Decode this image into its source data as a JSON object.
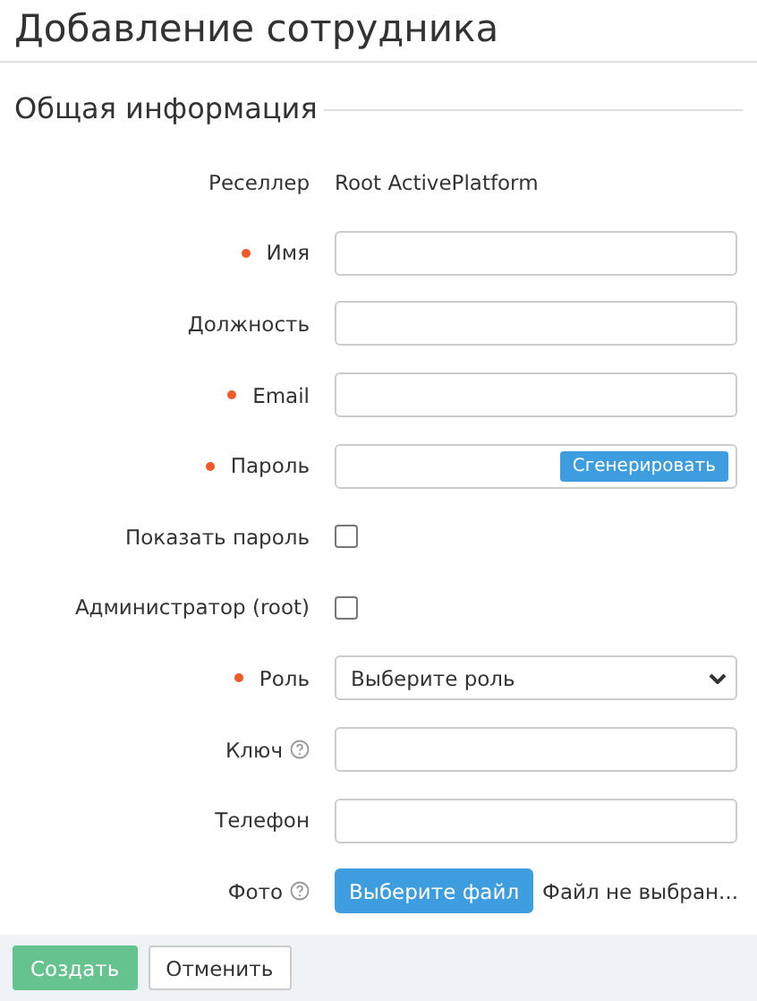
{
  "title": "Добавление сотрудника",
  "section": "Общая информация",
  "fields": [
    {
      "kind": "text",
      "label": "Реселлер",
      "required": false,
      "help": false,
      "value": "Root ActivePlatform"
    },
    {
      "kind": "input",
      "label": "Имя",
      "required": true,
      "help": false
    },
    {
      "kind": "input",
      "label": "Должность",
      "required": false,
      "help": false
    },
    {
      "kind": "input",
      "label": "Email",
      "required": true,
      "help": false
    },
    {
      "kind": "password",
      "label": "Пароль",
      "required": true,
      "help": false,
      "button": "Сгенерировать"
    },
    {
      "kind": "checkbox",
      "label": "Показать пароль",
      "required": false,
      "help": false,
      "checked": false
    },
    {
      "kind": "checkbox",
      "label": "Администратор (root)",
      "required": false,
      "help": false,
      "checked": false
    },
    {
      "kind": "select",
      "label": "Роль",
      "required": true,
      "help": false,
      "value": "Выберите роль"
    },
    {
      "kind": "input",
      "label": "Ключ",
      "required": false,
      "help": true
    },
    {
      "kind": "input",
      "label": "Телефон",
      "required": false,
      "help": false
    },
    {
      "kind": "file",
      "label": "Фото",
      "required": false,
      "help": true,
      "button": "Выберите файл",
      "status": "Файл не выбран..."
    }
  ],
  "buttons": [
    {
      "label": "Создать",
      "kind": "primary"
    },
    {
      "label": "Отменить",
      "kind": "secondary"
    }
  ]
}
